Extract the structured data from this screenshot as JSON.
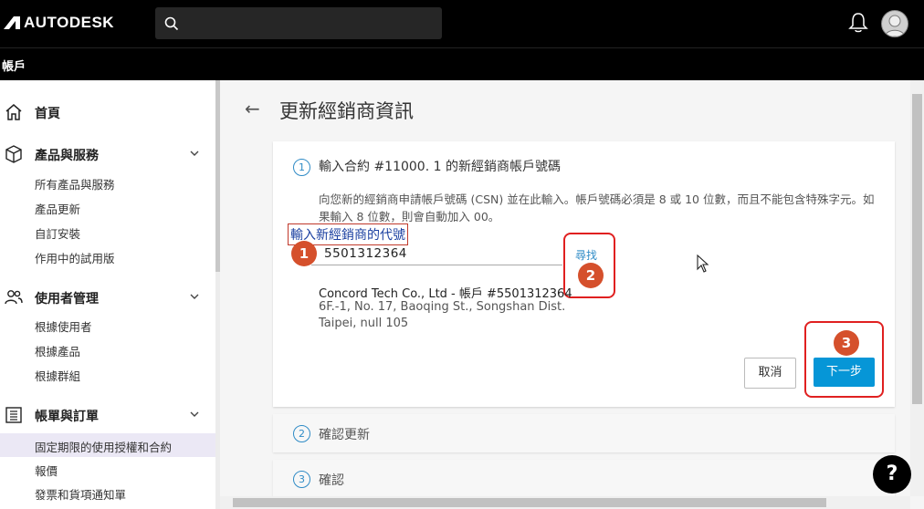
{
  "header": {
    "logo_text": "AUTODESK",
    "sub_title": "帳戶"
  },
  "sidebar": {
    "sections": [
      {
        "label": "首頁"
      },
      {
        "label": "產品與服務",
        "items": [
          "所有產品與服務",
          "產品更新",
          "自訂安裝",
          "作用中的試用版"
        ]
      },
      {
        "label": "使用者管理",
        "items": [
          "根據使用者",
          "根據產品",
          "根據群組"
        ]
      },
      {
        "label": "帳單與訂單",
        "items": [
          "固定期限的使用授權和合約",
          "報價",
          "發票和貨項通知單"
        ]
      }
    ]
  },
  "page": {
    "title": "更新經銷商資訊",
    "step1": {
      "number": "1",
      "title": "輸入合約 #11000.         1 的新經銷商帳戶號碼",
      "description": "向您新的經銷商申請帳戶號碼 (CSN) 並在此輸入。帳戶號碼必須是 8 或 10 位數，而且不能包含特殊字元。如果輸入 8 位數，則會自動加入 00。",
      "annotation": "輸入新經銷商的代號",
      "csn_value": "5501312364",
      "find_label": "尋找",
      "company": "Concord Tech Co., Ltd - 帳戶 #5501312364",
      "address_line1": "6F.-1, No. 17, Baoqing St., Songshan Dist.",
      "address_line2": "Taipei, null 105",
      "cancel_label": "取消",
      "next_label": "下一步"
    },
    "step2": {
      "number": "2",
      "title": "確認更新"
    },
    "step3": {
      "number": "3",
      "title": "確認"
    },
    "callouts": [
      "1",
      "2",
      "3"
    ]
  },
  "help_label": "?",
  "colors": {
    "accent": "#0696d7",
    "callout": "#d5502c",
    "annotation_border": "#e02020"
  }
}
